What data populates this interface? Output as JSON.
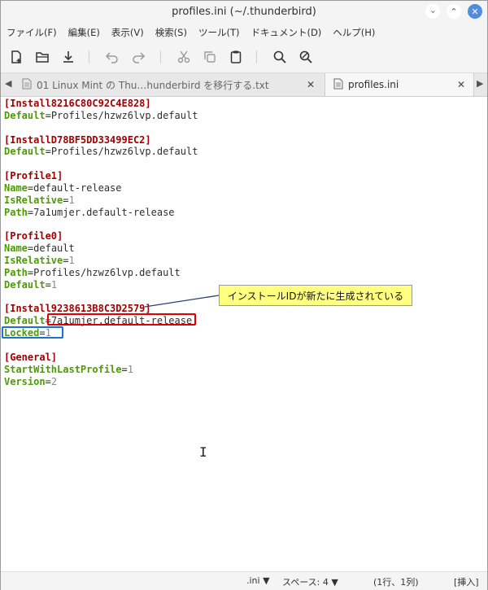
{
  "window": {
    "title": "profiles.ini (~/.thunderbird)"
  },
  "window_buttons": {
    "minimize": "‹",
    "maximize": "⌃",
    "close": "✕"
  },
  "menu": [
    "ファイル(F)",
    "編集(E)",
    "表示(V)",
    "検索(S)",
    "ツール(T)",
    "ドキュメント(D)",
    "ヘルプ(H)"
  ],
  "toolbar": {
    "icons": [
      "new-document-icon",
      "open-folder-icon",
      "save-icon",
      "undo-icon",
      "redo-icon",
      "cut-icon",
      "copy-icon",
      "paste-icon",
      "search-icon",
      "search-replace-icon"
    ]
  },
  "tabs": [
    {
      "label": "01 Linux Mint の Thu…hunderbird を移行する.txt",
      "close": "✕"
    },
    {
      "label": "profiles.ini",
      "close": "✕"
    }
  ],
  "editor": {
    "lines": [
      {
        "t": "section",
        "s": "[Install8216C80C92C4E828]"
      },
      {
        "t": "kv",
        "k": "Default",
        "v": "Profiles/hzwz6lvp.default"
      },
      {
        "t": "blank"
      },
      {
        "t": "section",
        "s": "[InstallD78BF5DD33499EC2]"
      },
      {
        "t": "kv",
        "k": "Default",
        "v": "Profiles/hzwz6lvp.default"
      },
      {
        "t": "blank"
      },
      {
        "t": "section",
        "s": "[Profile1]"
      },
      {
        "t": "kv",
        "k": "Name",
        "v": "default-release"
      },
      {
        "t": "kvn",
        "k": "IsRelative",
        "v": "1"
      },
      {
        "t": "kv",
        "k": "Path",
        "v": "7a1umjer.default-release"
      },
      {
        "t": "blank"
      },
      {
        "t": "section",
        "s": "[Profile0]"
      },
      {
        "t": "kv",
        "k": "Name",
        "v": "default"
      },
      {
        "t": "kvn",
        "k": "IsRelative",
        "v": "1"
      },
      {
        "t": "kv",
        "k": "Path",
        "v": "Profiles/hzwz6lvp.default"
      },
      {
        "t": "kvn",
        "k": "Default",
        "v": "1"
      },
      {
        "t": "blank"
      },
      {
        "t": "section",
        "s": "[Install9238613B8C3D2579]"
      },
      {
        "t": "kv",
        "k": "Default",
        "v": "7a1umjer.default-release"
      },
      {
        "t": "kvn",
        "k": "Locked",
        "v": "1"
      },
      {
        "t": "blank"
      },
      {
        "t": "section",
        "s": "[General]"
      },
      {
        "t": "kvn",
        "k": "StartWithLastProfile",
        "v": "1"
      },
      {
        "t": "kvn",
        "k": "Version",
        "v": "2"
      }
    ]
  },
  "annotation": {
    "text": "インストールIDが新たに生成されている"
  },
  "statusbar": {
    "filetype": ".ini ▼",
    "spaces": "スペース: 4 ▼",
    "position": "(1行、1列)",
    "mode": "[挿入]"
  },
  "colors": {
    "section": "#a40000",
    "key": "#4e9a06",
    "callout_bg": "#ffff80",
    "red_box": "#e00000",
    "blue_box": "#1e6fd0"
  }
}
